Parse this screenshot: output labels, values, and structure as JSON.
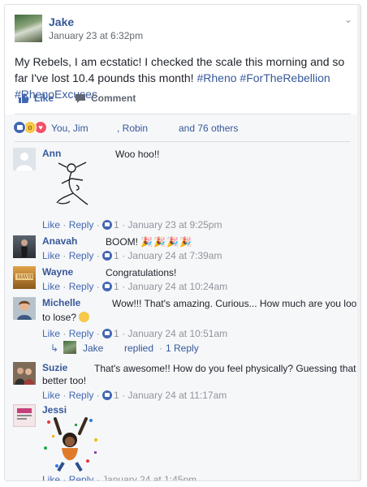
{
  "post": {
    "author": "Jake",
    "time": "January 23 at 6:32pm",
    "text_main": "My Rebels, I am ecstatic! I checked the scale this morning and so far I've lost 10.4 pounds this month! ",
    "hashtags": [
      "#Rheno",
      "#ForTheRebellion",
      "#RhenoExcuses"
    ]
  },
  "actions": {
    "like_label": "Like",
    "comment_label": "Comment"
  },
  "reactions": {
    "names_1": "You, Jim",
    "names_2": ", Robin",
    "others": "and 76 others"
  },
  "comments": [
    {
      "author": "Ann",
      "text": "Woo hoo!!",
      "like_label": "Like",
      "reply_label": "Reply",
      "likes": "1",
      "time": "January 23 at 9:25pm"
    },
    {
      "author": "Anavah",
      "text": "BOOM!",
      "like_label": "Like",
      "reply_label": "Reply",
      "likes": "1",
      "time": "January 24 at 7:39am"
    },
    {
      "author": "Wayne",
      "text": "Congratulations!",
      "like_label": "Like",
      "reply_label": "Reply",
      "likes": "1",
      "time": "January 24 at 10:24am"
    },
    {
      "author": "Michelle",
      "text_line1": "Wow!!! That's amazing. Curious... How much are you looking",
      "text_line2": "to lose?",
      "like_label": "Like",
      "reply_label": "Reply",
      "likes": "1",
      "time": "January 24 at 10:51am",
      "reply": {
        "author": "Jake",
        "replied": "replied",
        "count": "1 Reply"
      }
    },
    {
      "author": "Suzie",
      "text_line1": "That's awesome!! How do you feel physically? Guessing that is",
      "text_line2": "better too!",
      "like_label": "Like",
      "reply_label": "Reply",
      "likes": "1",
      "time": "January 24 at 11:17am"
    },
    {
      "author": "Jessi",
      "like_label": "Like",
      "reply_label": "Reply",
      "time": "January 24 at 1:45pm"
    }
  ]
}
